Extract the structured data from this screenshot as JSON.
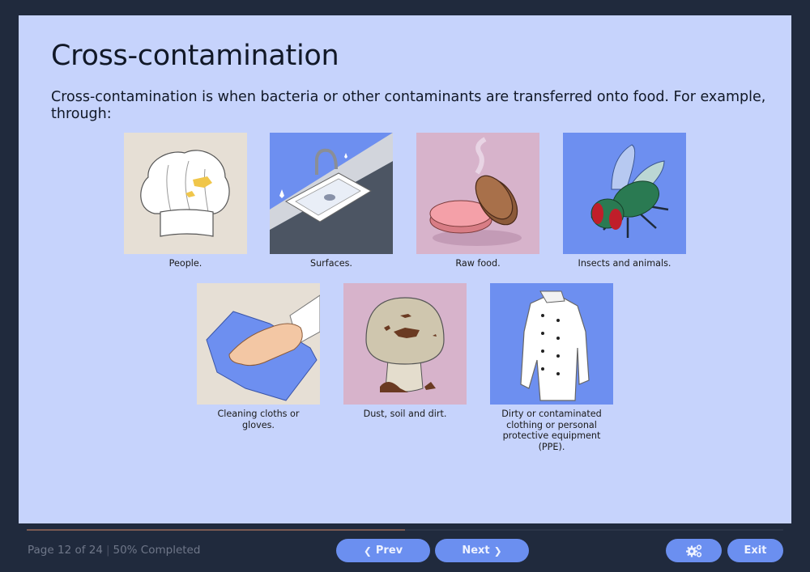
{
  "page": {
    "title": "Cross-contamination",
    "intro": "Cross-contamination is when bacteria or other contaminants are transferred onto food. For example, through:"
  },
  "items": [
    {
      "caption": "People.",
      "image": "chef-hat-with-stain",
      "bg": "#e6dfd5"
    },
    {
      "caption": "Surfaces.",
      "image": "kitchen-sink-counter",
      "bg": "#6d8ff0"
    },
    {
      "caption": "Raw food.",
      "image": "raw-and-cooked-burger-patties",
      "bg": "#d7b3cb"
    },
    {
      "caption": "Insects and animals.",
      "image": "housefly",
      "bg": "#6d8ff0"
    },
    {
      "caption": "Cleaning cloths or gloves.",
      "image": "hand-wiping-with-cloth",
      "bg": "#e6dfd5"
    },
    {
      "caption": "Dust, soil and dirt.",
      "image": "dirty-mushroom",
      "bg": "#d7b3cb"
    },
    {
      "caption": "Dirty or contaminated clothing or personal protective equipment (PPE).",
      "image": "chef-jacket",
      "bg": "#6d8ff0"
    }
  ],
  "footer": {
    "page_text": "Page 12 of 24",
    "separator": "|",
    "progress_text": "50% Completed",
    "progress_fraction": 0.5,
    "prev_label": "Prev",
    "next_label": "Next",
    "settings_icon": "gears-icon",
    "exit_label": "Exit"
  },
  "colors": {
    "frame": "#202a3d",
    "panel": "#c6d3fc",
    "button": "#6b8ff0",
    "progress": "#7a5a52"
  }
}
